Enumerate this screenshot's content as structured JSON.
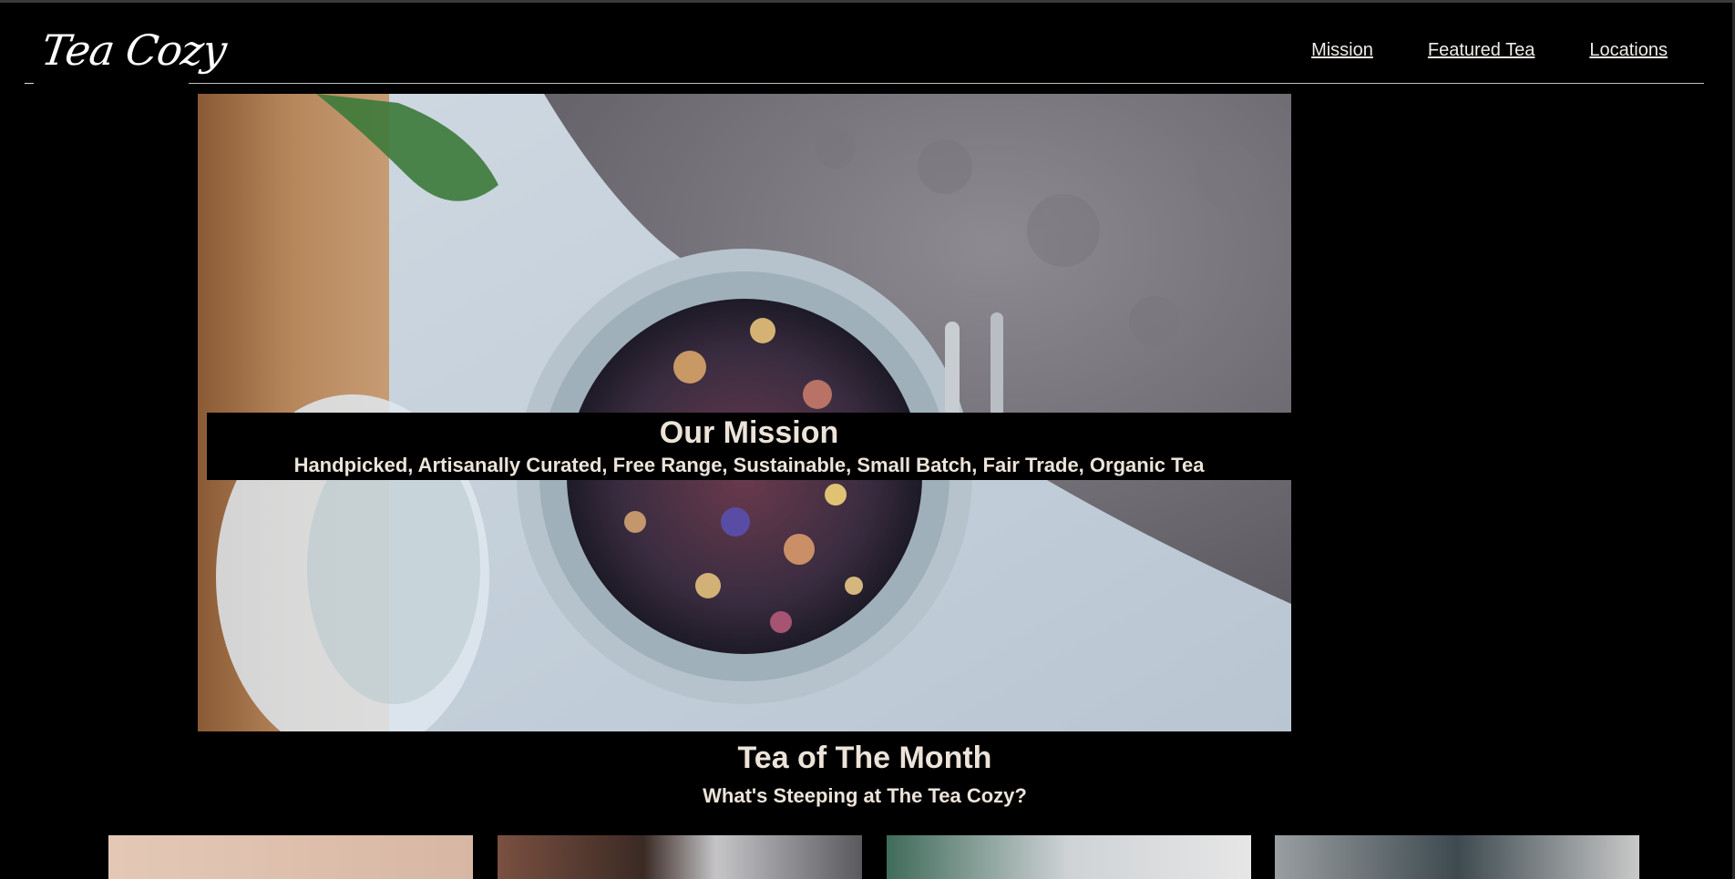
{
  "header": {
    "logo_text": "Tea Cozy",
    "nav": [
      {
        "label": "Mission"
      },
      {
        "label": "Featured Tea"
      },
      {
        "label": "Locations"
      }
    ]
  },
  "mission": {
    "title": "Our Mission",
    "subtitle": "Handpicked, Artisanally Curated, Free Range, Sustainable, Small Batch, Fair Trade, Organic Tea"
  },
  "tea_of_month": {
    "title": "Tea of The Month",
    "subtitle": "What's Steeping at The Tea Cozy?"
  },
  "colors": {
    "background": "#000000",
    "text": "#ece3d9",
    "nav_link": "#f0ece6"
  }
}
